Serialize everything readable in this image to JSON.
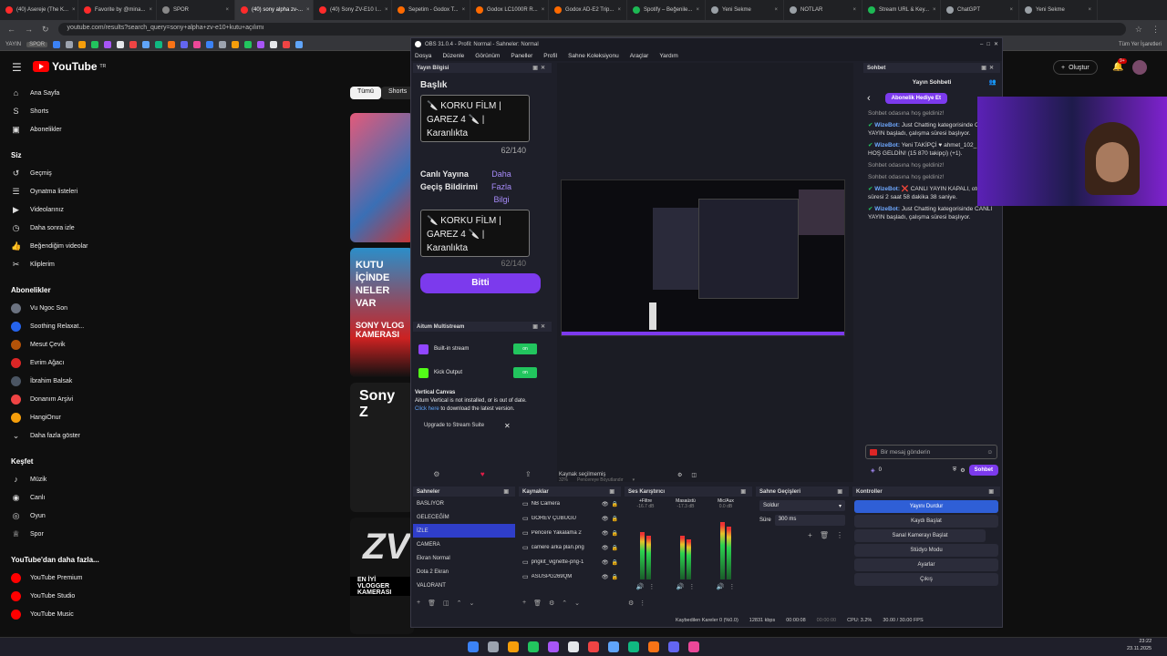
{
  "browser": {
    "tabs": [
      {
        "label": "(40) Asereje (The K...",
        "color": "#ff2b2b"
      },
      {
        "label": "Favorite by @mina...",
        "color": "#ff2b2b"
      },
      {
        "label": "SPOR",
        "color": "#888888"
      },
      {
        "label": "(40) sony alpha zv-...",
        "color": "#ff2b2b",
        "active": true
      },
      {
        "label": "(40) Sony ZV-E10 I...",
        "color": "#ff2b2b"
      },
      {
        "label": "Sepetim - Godox T...",
        "color": "#ff6a00"
      },
      {
        "label": "Godox LC1000R R...",
        "color": "#ff6a00"
      },
      {
        "label": "Godox AD-E2 Trip...",
        "color": "#ff6a00"
      },
      {
        "label": "Spotify – Beğenile...",
        "color": "#1db954"
      },
      {
        "label": "Yeni Sekme",
        "color": "#9aa0a6"
      },
      {
        "label": "NOTLAR",
        "color": "#9aa0a6"
      },
      {
        "label": "Stream URL & Key...",
        "color": "#1db954"
      },
      {
        "label": "ChatGPT",
        "color": "#9aa0a6"
      },
      {
        "label": "Yeni Sekme",
        "color": "#9aa0a6"
      }
    ],
    "url": "youtube.com/results?search_query=sony+alpha+zv-e10+kutu+açılımı",
    "bookmarks_right": "Tüm Yer İşaretleri",
    "bookmark_labels": [
      "YAYIN",
      "SPOR"
    ]
  },
  "youtube": {
    "logo_text": "YouTube",
    "logo_sup": "TR",
    "chips": [
      "Tümü",
      "Shorts"
    ],
    "create_label": "Oluştur",
    "notif_count": "9+",
    "sidebar_main": [
      {
        "label": "Ana Sayfa",
        "icon": "⌂"
      },
      {
        "label": "Shorts",
        "icon": "S"
      },
      {
        "label": "Abonelikler",
        "icon": "▣"
      }
    ],
    "you_header": "Siz",
    "sidebar_you": [
      {
        "label": "Geçmiş",
        "icon": "↺"
      },
      {
        "label": "Oynatma listeleri",
        "icon": "☰"
      },
      {
        "label": "Videolarınız",
        "icon": "▶"
      },
      {
        "label": "Daha sonra izle",
        "icon": "◷"
      },
      {
        "label": "Beğendiğim videolar",
        "icon": "👍"
      },
      {
        "label": "Kliplerim",
        "icon": "✂"
      }
    ],
    "subs_header": "Abonelikler",
    "sidebar_subs": [
      {
        "label": "Vu Ngoc Son",
        "color": "#6b7280"
      },
      {
        "label": "Soothing Relaxat...",
        "color": "#2563eb"
      },
      {
        "label": "Mesut Çevik",
        "color": "#b45309"
      },
      {
        "label": "Evrim Ağacı",
        "color": "#dc2626"
      },
      {
        "label": "İbrahim Balsak",
        "color": "#4b5563"
      },
      {
        "label": "Donanım Arşivi",
        "color": "#ef4444"
      },
      {
        "label": "HangiOnur",
        "color": "#f59e0b"
      },
      {
        "label": "Daha fazla göster",
        "color": ""
      }
    ],
    "explore_header": "Keşfet",
    "sidebar_explore": [
      {
        "label": "Müzik",
        "icon": "♪"
      },
      {
        "label": "Canlı",
        "icon": "◉"
      },
      {
        "label": "Oyun",
        "icon": "◎"
      },
      {
        "label": "Spor",
        "icon": "♕"
      }
    ],
    "more_header": "YouTube'dan daha fazla...",
    "sidebar_more": [
      {
        "label": "YouTube Premium"
      },
      {
        "label": "YouTube Studio"
      },
      {
        "label": "YouTube Music"
      }
    ],
    "thumb_texts": [
      "KUTU İÇİNDE NELER VAR",
      "SONY VLOG KAMERASI",
      "Sony Z",
      "ZV",
      "EN İYİ VLOGGER KAMERASI"
    ]
  },
  "obs": {
    "title": "OBS 31.0.4 - Profil: Normal - Sahneler: Normal",
    "menu": [
      "Dosya",
      "Düzenle",
      "Görünüm",
      "Paneller",
      "Profil",
      "Sahne Koleksiyonu",
      "Araçlar",
      "Yardım"
    ],
    "stream_info": {
      "dock_title": "Yayın Bilgisi",
      "title_label": "Başlık",
      "title_value": "🔪 KORKU FİLM | GAREZ 4 🔪 | Karanlıkta",
      "title_count": "62/140",
      "golive_label": "Canlı Yayına Geçiş Bildirimi",
      "more_info": "Daha Fazla Bilgi",
      "golive_value": "🔪 KORKU FİLM | GAREZ 4 🔪 | Karanlıkta",
      "golive_count": "62/140",
      "done_button": "Bitti"
    },
    "multistream": {
      "dock_title": "Aitum Multistream",
      "outputs": [
        {
          "label": "Built-in stream",
          "icon_color": "#9146ff",
          "state": "on"
        },
        {
          "label": "Kick Output",
          "icon_color": "#53fc18",
          "state": "on"
        }
      ],
      "vertical_title": "Vertical Canvas",
      "vertical_msg": "Aitum Vertical is not installed, or is out of date.",
      "click_here": "Click here",
      "download_msg": " to download the latest version.",
      "upgrade_button": "Upgrade to Stream Suite"
    },
    "preview": {
      "zoom": "32%",
      "fit_label": "Pencereye Boyutlandır",
      "no_source": "Kaynak seçilmemiş"
    },
    "scenes": {
      "dock_title": "Sahneler",
      "items": [
        "BASLIYOR",
        "GELECEĞİM",
        "İZLE",
        "CAMERA",
        "Ekran Normal",
        "Dota 2 Ekran",
        "VALORANT"
      ],
      "selected": 2
    },
    "sources": {
      "dock_title": "Kaynaklar",
      "items": [
        {
          "label": "NB Camera"
        },
        {
          "label": "GÖREV ÇUBUĞU"
        },
        {
          "label": "Pencere Yakalama 2"
        },
        {
          "label": "camere arka plan.png"
        },
        {
          "label": "pngkit_vignette-png-1"
        },
        {
          "label": "ASUSPG269QM"
        }
      ]
    },
    "mixer": {
      "dock_title": "Ses Karıştırıcı",
      "channels": [
        {
          "label": "+Filtre",
          "db": "-16.7 dB",
          "level": 0.7
        },
        {
          "label": "Masaüstü",
          "db": "-17.3 dB",
          "level": 0.65
        },
        {
          "label": "Mic/Aux",
          "db": "0.0 dB",
          "level": 0.85
        }
      ]
    },
    "transitions": {
      "dock_title": "Sahne Geçişleri",
      "type": "Soldur",
      "duration_label": "Süre",
      "duration": "300 ms"
    },
    "controls": {
      "dock_title": "Kontroller",
      "buttons": [
        "Yayını Durdur",
        "Kaydı Başlat",
        "Sanal Kamerayı Başlat",
        "Stüdyo Modu",
        "Ayarlar",
        "Çıkış"
      ]
    },
    "chat": {
      "dock_title": "Sohbet",
      "header": "Yayın Sohbeti",
      "gift_button": "Abonelik Hediye Et",
      "messages": [
        {
          "user": "",
          "text": "Sohbet odasına hoş geldiniz!"
        },
        {
          "user": "WizeBot:",
          "text": " Just Chatting kategorisinde CANLI YAYIN başladı, çalışma süresi başlıyor."
        },
        {
          "user": "WizeBot:",
          "text": " Yeni TAKİPÇİ ♥ ahmet_102_ ♥, HOŞ GELDİN! (15 870 takipçi) (+1)."
        },
        {
          "user": "",
          "text": "Sohbet odasına hoş geldiniz!"
        },
        {
          "user": "",
          "text": "Sohbet odasına hoş geldiniz!"
        },
        {
          "user": "WizeBot:",
          "text": " ❌ CANLI YAYIN KAPALI, oturum süresi 2 saat 58 dakika 38 saniye."
        },
        {
          "user": "WizeBot:",
          "text": " Just Chatting kategorisinde CANLI YAYIN başladı, çalışma süresi başlıyor."
        }
      ],
      "input_placeholder": "Bir mesaj gönderin",
      "points": "0",
      "send_button": "Sohbet"
    },
    "status": {
      "dropped": "Kaybedilen Kareler 0 (%0.0)",
      "bitrate": "12831 kbps",
      "live_time": "00:00:08",
      "rec_time": "00:00:00",
      "cpu": "CPU: 3.2%",
      "fps": "30.00 / 30.00 FPS"
    }
  },
  "taskbar": {
    "icons": [
      "#3b82f6",
      "#9ca3af",
      "#f59e0b",
      "#22c55e",
      "#a855f7",
      "#e5e7eb",
      "#ef4444",
      "#60a5fa",
      "#10b981",
      "#f97316",
      "#6366f1",
      "#ec4899"
    ],
    "time": "23:22",
    "date": "23.11.2025"
  }
}
